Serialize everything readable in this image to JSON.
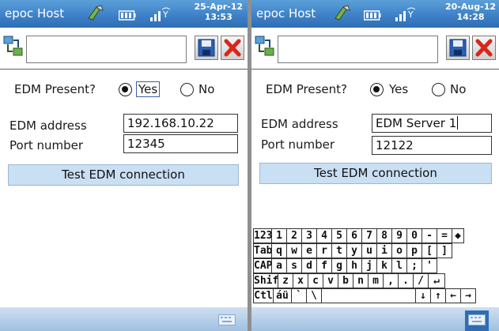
{
  "screens": [
    {
      "app_title": "epoc Host",
      "date": "25-Apr-12",
      "time": "13:53",
      "edm_present_label": "EDM Present?",
      "yes_label": "Yes",
      "no_label": "No",
      "edm_present_value": "Yes",
      "edm_address_label": "EDM address",
      "edm_address_value": "192.168.10.22",
      "port_label": "Port number",
      "port_value": "12345",
      "test_button_label": "Test EDM connection"
    },
    {
      "app_title": "epoc Host",
      "date": "20-Aug-12",
      "time": "14:28",
      "edm_present_label": "EDM Present?",
      "yes_label": "Yes",
      "no_label": "No",
      "edm_present_value": "Yes",
      "edm_address_label": "EDM address",
      "edm_address_value": "EDM Server 1",
      "port_label": "Port number",
      "port_value": "12122",
      "test_button_label": "Test EDM connection"
    }
  ],
  "keyboard": {
    "rows": [
      [
        "123",
        "1",
        "2",
        "3",
        "4",
        "5",
        "6",
        "7",
        "8",
        "9",
        "0",
        "-",
        "=",
        "◆"
      ],
      [
        "Tab",
        "q",
        "w",
        "e",
        "r",
        "t",
        "y",
        "u",
        "i",
        "o",
        "p",
        "[",
        "]"
      ],
      [
        "CAP",
        "a",
        "s",
        "d",
        "f",
        "g",
        "h",
        "j",
        "k",
        "l",
        ";",
        "'"
      ],
      [
        "Shift",
        "z",
        "x",
        "c",
        "v",
        "b",
        "n",
        "m",
        ",",
        ".",
        "/",
        "↵"
      ],
      [
        "Ctl",
        "áü",
        "`",
        "\\",
        " ",
        "↓",
        "↑",
        "←",
        "→"
      ]
    ]
  },
  "icons": {
    "sync": "sync-icon",
    "battery": "battery-icon",
    "signal": "signal-icon",
    "connection": "connection-icon",
    "save": "save-icon",
    "close": "close-icon",
    "keyboard": "keyboard-icon"
  },
  "colors": {
    "titlebar": "#3c7fc6",
    "button_bg": "#c9dff3",
    "bottombar": "#b5d0ea"
  }
}
